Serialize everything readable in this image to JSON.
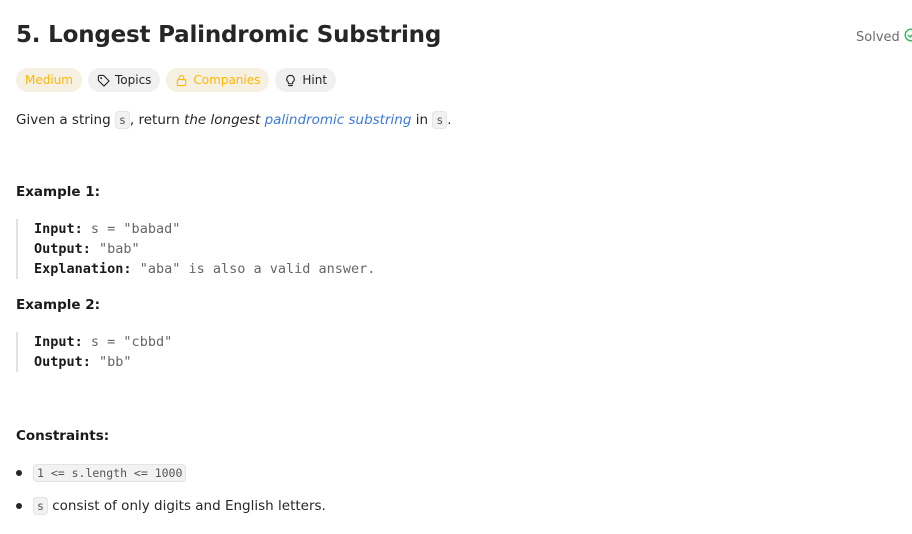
{
  "header": {
    "title": "5. Longest Palindromic Substring",
    "solved_label": "Solved",
    "solved_color": "#2cbb5d"
  },
  "tags": {
    "difficulty": "Medium",
    "topics": "Topics",
    "companies": "Companies",
    "hint": "Hint"
  },
  "description": {
    "prefix": "Given a string",
    "code_s": "s",
    "mid": ", return",
    "emph": "the longest",
    "link": "palindromic substring",
    "in": "in",
    "code_s2": "s",
    "suffix": "."
  },
  "examples": [
    {
      "title": "Example 1:",
      "input_label": "Input:",
      "input_value": "s = \"babad\"",
      "output_label": "Output:",
      "output_value": "\"bab\"",
      "explanation_label": "Explanation:",
      "explanation_value": "\"aba\" is also a valid answer."
    },
    {
      "title": "Example 2:",
      "input_label": "Input:",
      "input_value": "s = \"cbbd\"",
      "output_label": "Output:",
      "output_value": "\"bb\""
    }
  ],
  "constraints": {
    "title": "Constraints:",
    "items": [
      {
        "code": "1 <= s.length <= 1000",
        "text": ""
      },
      {
        "code": "s",
        "text": "consist of only digits and English letters."
      }
    ]
  },
  "colors": {
    "accent_link": "#3f7ad9",
    "medium": "#ffb800"
  }
}
